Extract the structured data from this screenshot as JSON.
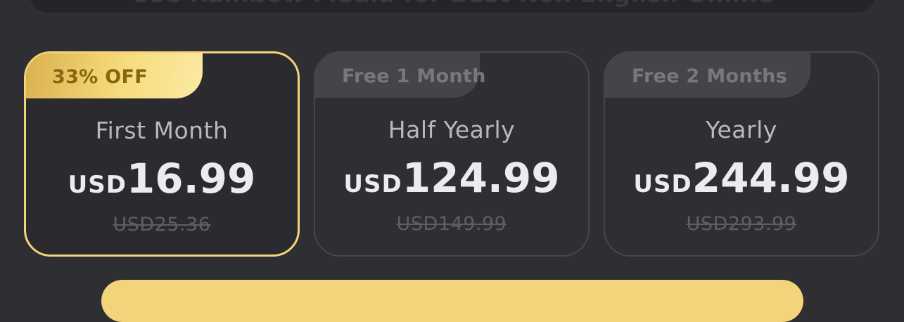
{
  "banner": {
    "text": "Use Rainbow Media for Best Non English Online"
  },
  "plans": [
    {
      "badge": "33% OFF",
      "name": "First Month",
      "currency": "USD",
      "price": "16.99",
      "original_price": "USD25.36",
      "selected": true
    },
    {
      "badge": "Free 1 Month",
      "name": "Half Yearly",
      "currency": "USD",
      "price": "124.99",
      "original_price": "USD149.99",
      "selected": false
    },
    {
      "badge": "Free 2 Months",
      "name": "Yearly",
      "currency": "USD",
      "price": "244.99",
      "original_price": "USD293.99",
      "selected": false
    }
  ],
  "colors": {
    "background": "#2f2f33",
    "selected_border": "#f3d47a",
    "badge_gold": "#f7dc7c",
    "badge_gray": "#454549"
  }
}
